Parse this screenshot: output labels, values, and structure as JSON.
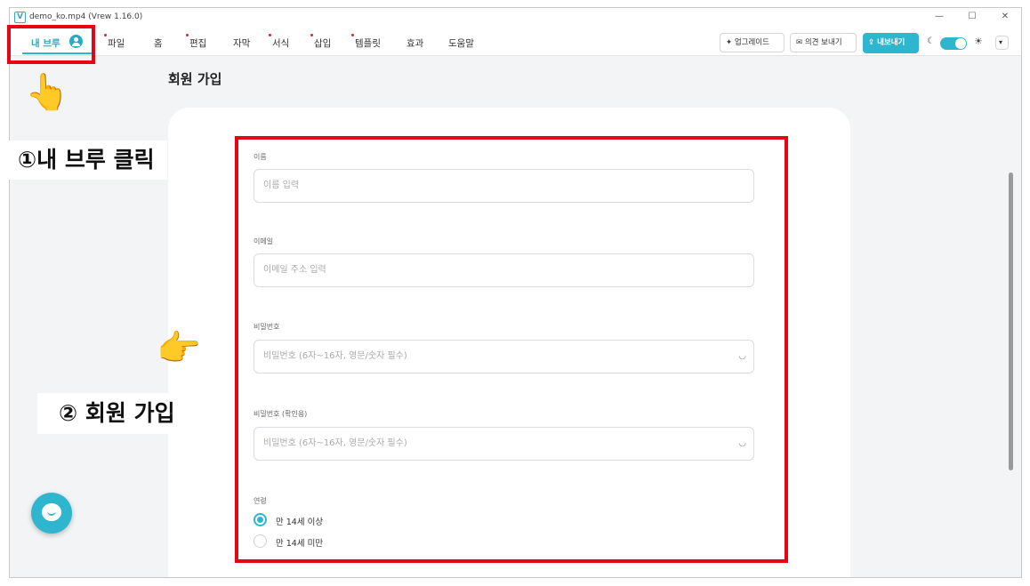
{
  "window": {
    "title": "demo_ko.mp4 (Vrew 1.16.0)",
    "controls": {
      "minimize": "—",
      "maximize": "☐",
      "close": "✕"
    }
  },
  "menubar": {
    "my_brew": "내 브루",
    "items": [
      {
        "label": "파일",
        "dot": true
      },
      {
        "label": "홈",
        "dot": false
      },
      {
        "label": "편집",
        "dot": true
      },
      {
        "label": "자막",
        "dot": false
      },
      {
        "label": "서식",
        "dot": true
      },
      {
        "label": "삽입",
        "dot": true
      },
      {
        "label": "템플릿",
        "dot": true
      },
      {
        "label": "효과",
        "dot": false
      },
      {
        "label": "도움말",
        "dot": false
      }
    ],
    "upgrade": "업그레이드",
    "feedback": "의견 보내기",
    "export": "내보내기",
    "more_glyph": "▾",
    "accent": "#2eb6cf"
  },
  "page": {
    "title": "회원 가입"
  },
  "form": {
    "name_label": "이름",
    "name_placeholder": "이름 입력",
    "email_label": "이메일",
    "email_placeholder": "이메일 주소 입력",
    "password_label": "비밀번호",
    "password_placeholder": "비밀번호 (6자~16자, 영문/숫자 필수)",
    "password_confirm_label": "비밀번호 (확인용)",
    "password_confirm_placeholder": "비밀번호 (6자~16자, 영문/숫자 필수)",
    "age_label": "연령",
    "age_options": [
      {
        "label": "만 14세 이상",
        "checked": true
      },
      {
        "label": "만 14세 미만",
        "checked": false
      }
    ]
  },
  "annotations": {
    "step1": "①내 브루 클릭",
    "step2": "② 회원 가입",
    "highlight_color": "#e30613"
  }
}
